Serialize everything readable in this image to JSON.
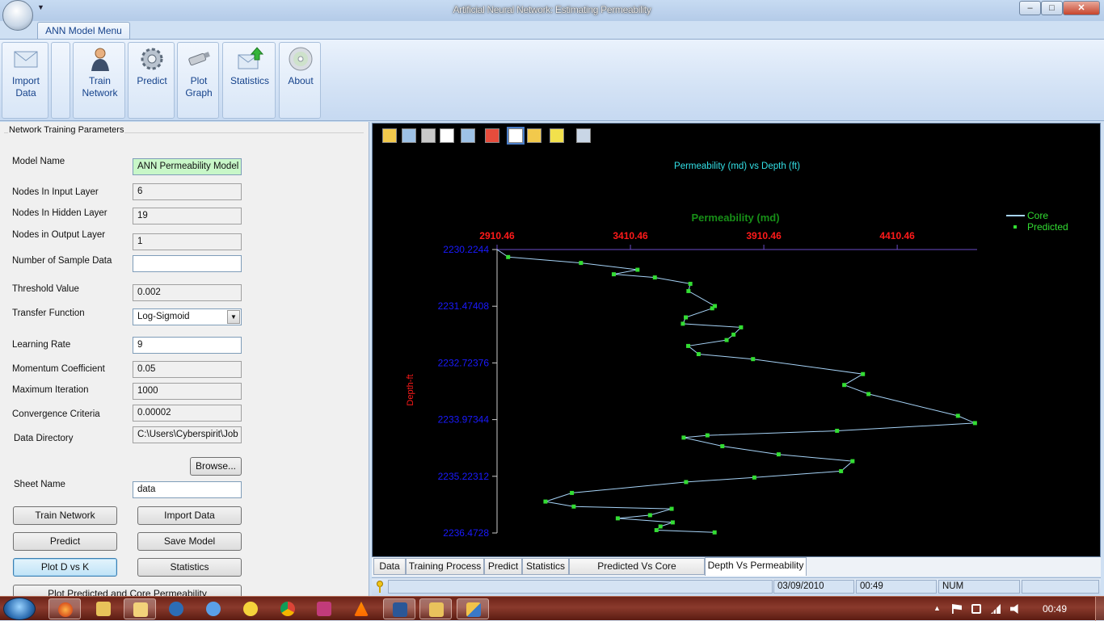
{
  "window": {
    "title": "Artificial Neural Network: Estimating Permeability",
    "minimize": "–",
    "maximize": "□",
    "close": "✕"
  },
  "ribbon": {
    "tab": "ANN Model Menu",
    "buttons": [
      {
        "id": "import",
        "label": "Import Data",
        "icon": "envelope-icon"
      },
      {
        "id": "train",
        "label": "Train Network",
        "icon": "person-icon"
      },
      {
        "id": "predict",
        "label": "Predict",
        "icon": "gear-icon"
      },
      {
        "id": "plot",
        "label": "Plot Graph",
        "icon": "usb-drive-icon"
      },
      {
        "id": "statistics",
        "label": "Statistics",
        "icon": "envelope-upload-icon"
      },
      {
        "id": "about",
        "label": "About",
        "icon": "disc-icon"
      }
    ]
  },
  "params": {
    "group_title": "Network Training Parameters",
    "model_name_label": "Model Name",
    "model_name": "ANN Permeability Model",
    "input_nodes_label": "Nodes In Input Layer",
    "input_nodes": "6",
    "hidden_nodes_label": "Nodes In Hidden Layer",
    "hidden_nodes": "19",
    "output_nodes_label": "Nodes in Output Layer",
    "output_nodes": "1",
    "sample_data_label": "Number of  Sample Data",
    "sample_data": "",
    "threshold_label": "Threshold Value",
    "threshold": "0.002",
    "transfer_label": "Transfer Function",
    "transfer": "Log-Sigmoid",
    "learning_rate_label": "Learning Rate",
    "learning_rate": "9",
    "momentum_label": "Momentum Coefficient",
    "momentum": "0.05",
    "max_iter_label": "Maximum Iteration",
    "max_iter": "1000",
    "convergence_label": "Convergence Criteria",
    "convergence": "0.00002",
    "data_dir_label": "Data Directory",
    "data_dir": "C:\\Users\\Cyberspirit\\Job",
    "browse": "Browse...",
    "sheet_label": "Sheet Name",
    "sheet": "data"
  },
  "actions": {
    "train": "Train Network",
    "import": "Import Data",
    "predict": "Predict",
    "save": "Save Model",
    "plot": "Plot D vs K",
    "statistics": "Statistics",
    "plot_core": "Plot Predicted and Core Permeability"
  },
  "chart_toolbar_icons": [
    "save-icon",
    "copy-icon",
    "print-icon",
    "zoom-icon",
    "export-icon",
    "color-icon",
    "properties-icon",
    "3d-icon",
    "axis-icon",
    "edit-icon"
  ],
  "chart_data": {
    "type": "line",
    "title": "Permeability (md) vs Depth (ft)",
    "xlabel": "Permeability (md)",
    "ylabel": "Depth-ft",
    "x_ticks": [
      "2910.46",
      "3410.46",
      "3910.46",
      "4410.46"
    ],
    "y_ticks": [
      "2230.2244",
      "2231.47408",
      "2232.72376",
      "2233.97344",
      "2235.22312",
      "2236.4728"
    ],
    "xlim": [
      2910.46,
      4710
    ],
    "ylim": [
      2230.2244,
      2236.4728
    ],
    "legend": [
      "Core",
      "Predicted"
    ],
    "legend_position": "top-right",
    "colors": {
      "core": "#a6d3f7",
      "predicted": "#33dd33",
      "title": "#33e0e6",
      "xlabel": "#178f17",
      "xticks": "#ff1a1a",
      "yticks": "#1a1aff",
      "ylabel": "#ff1a1a",
      "axis": "#6a4cc8"
    },
    "series": [
      {
        "name": "Core",
        "points": [
          [
            2910.46,
            2230.2244
          ],
          [
            2952,
            2230.39
          ],
          [
            3225,
            2230.52
          ],
          [
            3437,
            2230.67
          ],
          [
            3348,
            2230.77
          ],
          [
            3502,
            2230.84
          ],
          [
            3635,
            2230.98
          ],
          [
            3628,
            2231.14
          ],
          [
            3727,
            2231.47
          ],
          [
            3717,
            2231.52
          ],
          [
            3618,
            2231.72
          ],
          [
            3607,
            2231.86
          ],
          [
            3825,
            2231.94
          ],
          [
            3797,
            2232.1
          ],
          [
            3771,
            2232.22
          ],
          [
            3627,
            2232.35
          ],
          [
            3666,
            2232.53
          ],
          [
            3870,
            2232.64
          ],
          [
            4282,
            2232.97
          ],
          [
            4212,
            2233.21
          ],
          [
            4303,
            2233.41
          ],
          [
            4638,
            2233.89
          ],
          [
            4702,
            2234.05
          ],
          [
            4185,
            2234.22
          ],
          [
            3699,
            2234.32
          ],
          [
            3610,
            2234.37
          ],
          [
            3755,
            2234.56
          ],
          [
            3966,
            2234.74
          ],
          [
            4243,
            2234.89
          ],
          [
            4200,
            2235.11
          ],
          [
            3875,
            2235.25
          ],
          [
            3619,
            2235.35
          ],
          [
            3191,
            2235.59
          ],
          [
            3092,
            2235.78
          ],
          [
            3198,
            2235.89
          ],
          [
            3565,
            2235.94
          ],
          [
            3484,
            2236.08
          ],
          [
            3363,
            2236.15
          ],
          [
            3569,
            2236.24
          ],
          [
            3523,
            2236.33
          ],
          [
            3508,
            2236.41
          ],
          [
            3726,
            2236.46
          ]
        ]
      },
      {
        "name": "Predicted",
        "points": [
          [
            2952,
            2230.39
          ],
          [
            3225,
            2230.52
          ],
          [
            3437,
            2230.67
          ],
          [
            3348,
            2230.77
          ],
          [
            3502,
            2230.84
          ],
          [
            3635,
            2230.98
          ],
          [
            3628,
            2231.14
          ],
          [
            3727,
            2231.47
          ],
          [
            3717,
            2231.52
          ],
          [
            3618,
            2231.72
          ],
          [
            3607,
            2231.86
          ],
          [
            3825,
            2231.94
          ],
          [
            3797,
            2232.1
          ],
          [
            3771,
            2232.22
          ],
          [
            3627,
            2232.35
          ],
          [
            3666,
            2232.53
          ],
          [
            3870,
            2232.64
          ],
          [
            4282,
            2232.97
          ],
          [
            4212,
            2233.21
          ],
          [
            4303,
            2233.41
          ],
          [
            4638,
            2233.89
          ],
          [
            4702,
            2234.05
          ],
          [
            4185,
            2234.22
          ],
          [
            3699,
            2234.32
          ],
          [
            3610,
            2234.37
          ],
          [
            3755,
            2234.56
          ],
          [
            3966,
            2234.74
          ],
          [
            4243,
            2234.89
          ],
          [
            4200,
            2235.11
          ],
          [
            3875,
            2235.25
          ],
          [
            3619,
            2235.35
          ],
          [
            3191,
            2235.59
          ],
          [
            3092,
            2235.78
          ],
          [
            3198,
            2235.89
          ],
          [
            3565,
            2235.94
          ],
          [
            3484,
            2236.08
          ],
          [
            3363,
            2236.15
          ],
          [
            3569,
            2236.24
          ],
          [
            3523,
            2236.33
          ],
          [
            3508,
            2236.41
          ],
          [
            3726,
            2236.46
          ]
        ]
      }
    ]
  },
  "bottom_tabs": [
    "Data",
    "Training Process",
    "Predict",
    "Statistics",
    "Predicted Vs Core Permeability",
    "Depth Vs Permeability"
  ],
  "active_tab": "Depth Vs Permeability",
  "status": {
    "icon": "key-icon",
    "date": "03/09/2010",
    "time": "00:49",
    "num": "NUM"
  },
  "taskbar": {
    "clock": "00:49",
    "apps": [
      "firefox-icon",
      "explorer-folder-icon",
      "file-manager-icon",
      "hp-icon",
      "itunes-icon",
      "messenger-icon",
      "chrome-icon",
      "winrar-icon",
      "vlc-icon",
      "word-icon",
      "project-icon",
      "ann-app-icon"
    ],
    "tray": [
      "tray-arrow-icon",
      "flag-icon",
      "power-icon",
      "signal-icon",
      "volume-muted-icon"
    ]
  }
}
